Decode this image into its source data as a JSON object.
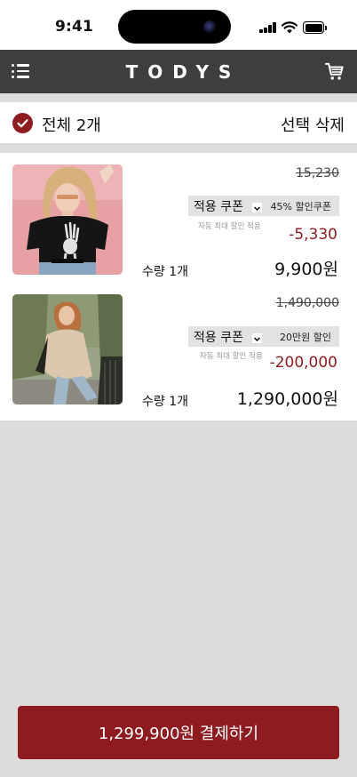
{
  "status_bar": {
    "time": "9:41"
  },
  "header": {
    "logo": "TODYS",
    "menu_icon": "menu-icon",
    "cart_icon": "cart-icon"
  },
  "selection": {
    "select_all_label": "전체 2개",
    "delete_selected_label": "선택 삭제",
    "checked": true
  },
  "items": [
    {
      "image": "woman-skeleton-hand-tshirt-photo",
      "original_price": "15,230",
      "coupon_label": "적용 쿠폰",
      "coupon_name": "45% 할인쿠폰",
      "auto_note": "자동 최대 할인 적용",
      "discount": "-5,330",
      "quantity": "수량 1개",
      "final_price": "9,900원"
    },
    {
      "image": "woman-beige-jacket-street-photo",
      "original_price": "1,490,000",
      "coupon_label": "적용 쿠폰",
      "coupon_name": "20만원 할인",
      "auto_note": "자동 최대 할인 적용",
      "discount": "-200,000",
      "quantity": "수량 1개",
      "final_price": "1,290,000원"
    }
  ],
  "checkout": {
    "label": "1,299,900원 결제하기"
  },
  "colors": {
    "accent": "#8e1b1f",
    "header_bg": "#3e3e3e",
    "page_bg": "#dcdcdc",
    "coupon_bg": "#e2e2e2"
  }
}
